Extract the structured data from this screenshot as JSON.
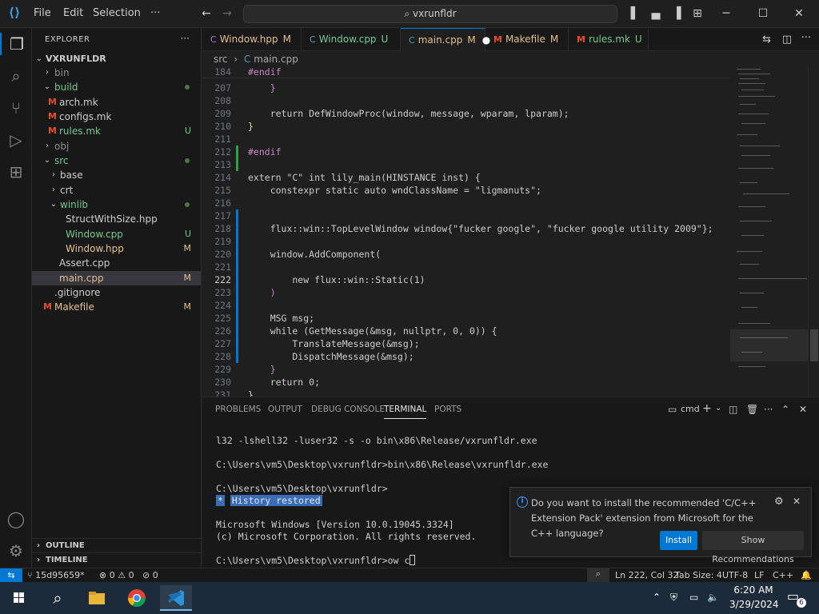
{
  "menu": {
    "file": "File",
    "edit": "Edit",
    "selection": "Selection",
    "more": "···"
  },
  "command_center": {
    "text": "vxrunfldr"
  },
  "explorer": {
    "title": "EXPLORER",
    "more": "···",
    "root": "VXRUNFLDR",
    "items": [
      {
        "label": "bin",
        "badge": ""
      },
      {
        "label": "build",
        "badge": ""
      },
      {
        "label": "arch.mk",
        "badge": ""
      },
      {
        "label": "configs.mk",
        "badge": ""
      },
      {
        "label": "rules.mk",
        "badge": "U"
      },
      {
        "label": "obj",
        "badge": ""
      },
      {
        "label": "src",
        "badge": ""
      },
      {
        "label": "base",
        "badge": ""
      },
      {
        "label": "crt",
        "badge": ""
      },
      {
        "label": "winlib",
        "badge": ""
      },
      {
        "label": "StructWithSize.hpp",
        "badge": ""
      },
      {
        "label": "Window.cpp",
        "badge": "U"
      },
      {
        "label": "Window.hpp",
        "badge": "M"
      },
      {
        "label": "Assert.cpp",
        "badge": ""
      },
      {
        "label": "main.cpp",
        "badge": "M"
      },
      {
        "label": ".gitignore",
        "badge": ""
      },
      {
        "label": "Makefile",
        "badge": "M"
      }
    ],
    "outline": "OUTLINE",
    "timeline": "TIMELINE"
  },
  "tabs": [
    {
      "label": "Window.hpp",
      "status": "M"
    },
    {
      "label": "Window.cpp",
      "status": "U"
    },
    {
      "label": "main.cpp",
      "status": "M"
    },
    {
      "label": "Makefile",
      "status": "M"
    },
    {
      "label": "rules.mk",
      "status": "U"
    }
  ],
  "breadcrumb": {
    "folder": "src",
    "sep": "›",
    "file": "main.cpp"
  },
  "editor": {
    "lines": [
      {
        "n": "184",
        "text": "#endif"
      },
      {
        "n": "207",
        "text": "    }"
      },
      {
        "n": "208",
        "text": ""
      },
      {
        "n": "209",
        "text": "    return DefWindowProc(window, message, wparam, lparam);"
      },
      {
        "n": "210",
        "text": "}"
      },
      {
        "n": "211",
        "text": ""
      },
      {
        "n": "212",
        "text": "#endif"
      },
      {
        "n": "213",
        "text": ""
      },
      {
        "n": "214",
        "text": "extern \"C\" int lily_main(HINSTANCE inst) {"
      },
      {
        "n": "215",
        "text": "    constexpr static auto wndClassName = \"ligmanuts\";"
      },
      {
        "n": "216",
        "text": ""
      },
      {
        "n": "217",
        "text": ""
      },
      {
        "n": "218",
        "text": "    flux::win::TopLevelWindow window{\"fucker google\", \"fucker google utility 2009\"};"
      },
      {
        "n": "219",
        "text": ""
      },
      {
        "n": "220",
        "text": "    window.AddComponent("
      },
      {
        "n": "221",
        "text": ""
      },
      {
        "n": "222",
        "text": "        new flux::win::Static(1)"
      },
      {
        "n": "223",
        "text": "    )"
      },
      {
        "n": "224",
        "text": ""
      },
      {
        "n": "225",
        "text": "    MSG msg;"
      },
      {
        "n": "226",
        "text": "    while (GetMessage(&msg, nullptr, 0, 0)) {"
      },
      {
        "n": "227",
        "text": "        TranslateMessage(&msg);"
      },
      {
        "n": "228",
        "text": "        DispatchMessage(&msg);"
      },
      {
        "n": "229",
        "text": "    }"
      },
      {
        "n": "230",
        "text": "    return 0;"
      },
      {
        "n": "231",
        "text": "}"
      }
    ]
  },
  "panel": {
    "tabs": [
      "PROBLEMS",
      "OUTPUT",
      "DEBUG CONSOLE",
      "TERMINAL",
      "PORTS"
    ],
    "shell": "cmd",
    "terminal": [
      "l32 -lshell32 -luser32 -s -o bin\\x86\\Release/vxrunfldr.exe",
      "",
      "C:\\Users\\vm5\\Desktop\\vxrunfldr>bin\\x86\\Release\\vxrunfldr.exe",
      "",
      "C:\\Users\\vm5\\Desktop\\vxrunfldr>",
      "History restored",
      "",
      "Microsoft Windows [Version 10.0.19045.3324]",
      "(c) Microsoft Corporation. All rights reserved.",
      "",
      "C:\\Users\\vm5\\Desktop\\vxrunfldr>ow c"
    ],
    "history_marker": "*"
  },
  "notification": {
    "message": "Do you want to install the recommended 'C/C++ Extension Pack' extension from Microsoft for the C++ language?",
    "install": "Install",
    "show": "Show Recommendations"
  },
  "status": {
    "branch": "15d95659*",
    "errors": "0",
    "warnings": "0",
    "ports": "0",
    "position": "Ln 222, Col 32",
    "tabsize": "Tab Size: 4",
    "encoding": "UTF-8",
    "eol": "LF",
    "language": "C++"
  },
  "taskbar": {
    "time": "6:20 AM",
    "date": "3/29/2024",
    "notif_count": "6"
  },
  "colors": {
    "accent": "#0078d4",
    "added": "#2ea043",
    "modified": "#e2c08d",
    "untracked": "#73c991"
  }
}
